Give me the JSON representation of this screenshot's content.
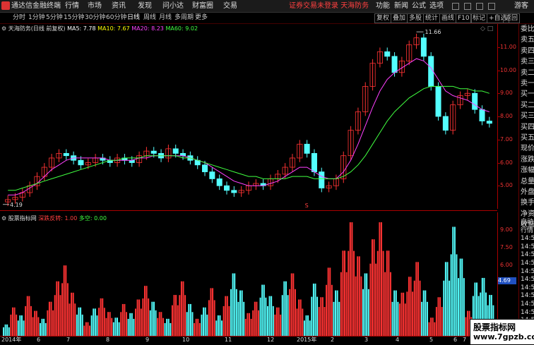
{
  "menubar": {
    "app_title": "通达信金融终端",
    "items": [
      "行情",
      "市场",
      "资讯",
      "发现",
      "问小达",
      "财富圈",
      "交易"
    ],
    "login_status": "证券交易未登录",
    "stock_name": "天海防务",
    "right_items": [
      "功能",
      "新闻",
      "公式",
      "选项"
    ],
    "guest": "游客"
  },
  "toolbar": {
    "periods": [
      "分时",
      "1分钟",
      "5分钟",
      "15分钟",
      "30分钟",
      "60分钟",
      "日线",
      "周线",
      "月线",
      "多周期",
      "更多"
    ],
    "active_period": "日线",
    "buttons": [
      "复权",
      "叠加",
      "多股",
      "统计",
      "画线",
      "F10",
      "标记",
      "+自选",
      "返回"
    ]
  },
  "main_legend": {
    "title": "天海防务(日线 前复权)",
    "ma": [
      {
        "label": "MA5: 7.78",
        "color": "#ffffff"
      },
      {
        "label": "MA10: 7.67",
        "color": "#ffff00"
      },
      {
        "label": "MA20: 8.23",
        "color": "#ff40ff"
      },
      {
        "label": "MA60: 9.02",
        "color": "#40ff40"
      }
    ]
  },
  "indicator_legend": {
    "title": "股票指标网",
    "items": [
      {
        "label": "深跌反转: 1.00",
        "color": "#ff4040"
      },
      {
        "label": "多空: 0.00",
        "color": "#40ff40"
      }
    ]
  },
  "annotations": {
    "high": "11.66",
    "low": "4.19",
    "s_mark": "S"
  },
  "price_axis": [
    "11.00",
    "10.00",
    "9.00",
    "8.00",
    "7.00",
    "6.00",
    "5.00"
  ],
  "indicator_axis": {
    "ticks": [
      "9.00",
      "7.50",
      "6.00",
      "4.50"
    ],
    "current": "4.69"
  },
  "date_axis": [
    "2014年",
    "6",
    "7",
    "8",
    "9",
    "10",
    "11",
    "12",
    "2015年",
    "2",
    "3",
    "4",
    "5",
    "6",
    "7"
  ],
  "side_panel": {
    "labels": [
      "委比",
      "卖五",
      "卖四",
      "卖三",
      "卖二",
      "卖一",
      "买一",
      "买二",
      "买三",
      "买四",
      "买五",
      "现价",
      "涨跌",
      "涨幅",
      "总量",
      "外盘",
      "换手",
      "净资",
      "收益"
    ],
    "labels2": [
      "自动",
      "行情",
      "14:5",
      "14:5",
      "14:5",
      "14:5",
      "14:5",
      "14:5",
      "14:5",
      "14:5",
      "14:5",
      "14:5",
      "14:5"
    ]
  },
  "watermark": {
    "title": "股票指标网",
    "url": "www.7gpzb.com"
  },
  "colors": {
    "up": "#ff3333",
    "down": "#54ffff",
    "grid": "#a00000"
  },
  "chart_data": {
    "type": "candlestick",
    "title": "天海防务(日线 前复权)",
    "ylim": [
      4.0,
      12.0
    ],
    "y_ticks": [
      5,
      6,
      7,
      8,
      9,
      10,
      11
    ],
    "close_series": [
      4.4,
      4.5,
      4.7,
      5.0,
      5.4,
      5.8,
      6.2,
      6.4,
      6.3,
      6.1,
      5.9,
      6.0,
      6.2,
      6.1,
      6.0,
      6.2,
      6.1,
      6.0,
      6.3,
      6.5,
      6.4,
      6.2,
      6.6,
      6.4,
      6.3,
      6.1,
      5.9,
      5.6,
      5.3,
      5.0,
      4.8,
      4.7,
      4.8,
      5.0,
      5.1,
      5.0,
      5.3,
      5.5,
      5.8,
      6.2,
      6.8,
      6.4,
      5.6,
      4.9,
      5.0,
      5.3,
      6.3,
      7.4,
      8.2,
      9.3,
      10.3,
      10.8,
      10.6,
      9.9,
      10.4,
      11.1,
      11.4,
      10.6,
      9.3,
      8.0,
      7.4,
      8.5,
      8.9,
      9.0,
      8.3,
      7.8,
      7.7
    ],
    "ma_series": [
      {
        "name": "MA20",
        "color": "#ff40ff",
        "values": [
          4.6,
          4.6,
          4.7,
          4.9,
          5.1,
          5.4,
          5.7,
          5.9,
          6.1,
          6.2,
          6.2,
          6.2,
          6.2,
          6.2,
          6.1,
          6.1,
          6.1,
          6.1,
          6.2,
          6.2,
          6.3,
          6.3,
          6.3,
          6.3,
          6.3,
          6.2,
          6.1,
          6.0,
          5.8,
          5.6,
          5.4,
          5.2,
          5.1,
          5.0,
          5.0,
          5.0,
          5.1,
          5.2,
          5.4,
          5.6,
          5.8,
          5.8,
          5.6,
          5.4,
          5.3,
          5.3,
          5.6,
          6.1,
          6.8,
          7.6,
          8.4,
          9.1,
          9.6,
          9.9,
          10.1,
          10.3,
          10.5,
          10.4,
          10.1,
          9.6,
          9.1,
          8.9,
          8.8,
          8.7,
          8.5,
          8.3,
          8.2
        ]
      },
      {
        "name": "MA60",
        "color": "#40ff40",
        "values": [
          4.8,
          4.8,
          4.9,
          5.0,
          5.1,
          5.2,
          5.3,
          5.4,
          5.5,
          5.6,
          5.7,
          5.8,
          5.9,
          6.0,
          6.1,
          6.1,
          6.2,
          6.2,
          6.2,
          6.3,
          6.3,
          6.3,
          6.3,
          6.3,
          6.2,
          6.2,
          6.1,
          6.0,
          5.9,
          5.8,
          5.7,
          5.6,
          5.5,
          5.4,
          5.4,
          5.3,
          5.3,
          5.3,
          5.3,
          5.4,
          5.4,
          5.4,
          5.3,
          5.3,
          5.3,
          5.3,
          5.4,
          5.6,
          5.9,
          6.3,
          6.8,
          7.3,
          7.8,
          8.2,
          8.5,
          8.8,
          9.0,
          9.2,
          9.3,
          9.3,
          9.3,
          9.3,
          9.2,
          9.2,
          9.1,
          9.1,
          9.0
        ]
      }
    ],
    "indicator": {
      "type": "bar",
      "ylim": [
        0,
        10.5
      ],
      "values": [
        1.0,
        2.5,
        1.8,
        3.5,
        2.2,
        1.5,
        3.0,
        4.8,
        6.2,
        3.8,
        2.5,
        1.2,
        2.4,
        3.3,
        2.1,
        1.6,
        2.8,
        2.0,
        3.2,
        4.4,
        3.0,
        2.1,
        1.5,
        3.6,
        4.8,
        2.8,
        1.5,
        2.5,
        4.2,
        1.8,
        3.5,
        5.5,
        4.0,
        2.0,
        3.0,
        4.5,
        3.5,
        2.5,
        4.8,
        5.5,
        3.2,
        1.8,
        4.6,
        3.4,
        6.0,
        4.0,
        7.5,
        10.0,
        7.0,
        5.5,
        8.5,
        10.0,
        7.5,
        4.0,
        3.8,
        5.2,
        6.5,
        4.0,
        1.6,
        3.4,
        6.5,
        9.6,
        6.8,
        2.2,
        4.69,
        5.1,
        3.6
      ],
      "colors": [
        "down",
        "up",
        "down",
        "up",
        "up",
        "down",
        "up",
        "up",
        "up",
        "up",
        "down",
        "up",
        "down",
        "up",
        "up",
        "down",
        "up",
        "down",
        "up",
        "up",
        "down",
        "up",
        "down",
        "up",
        "up",
        "down",
        "up",
        "down",
        "up",
        "down",
        "up",
        "down",
        "down",
        "up",
        "up",
        "down",
        "down",
        "up",
        "down",
        "up",
        "up",
        "down",
        "down",
        "up",
        "up",
        "down",
        "up",
        "up",
        "up",
        "down",
        "up",
        "up",
        "up",
        "down",
        "up",
        "up",
        "up",
        "down",
        "up",
        "up",
        "down",
        "down",
        "down",
        "up",
        "down",
        "down",
        "down"
      ]
    }
  }
}
